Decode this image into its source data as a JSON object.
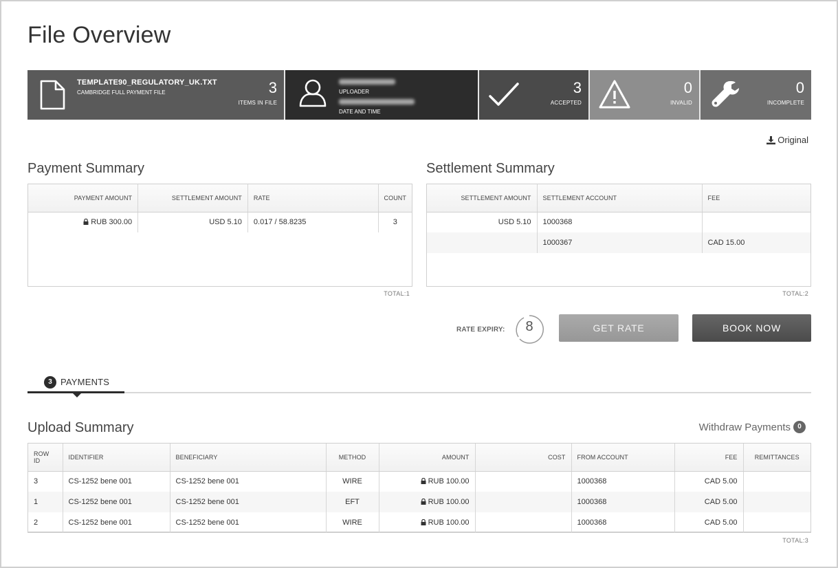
{
  "page": {
    "title": "File Overview"
  },
  "stats": {
    "file": {
      "name": "TEMPLATE90_REGULATORY_UK.TXT",
      "subtitle": "CAMBRIDGE FULL PAYMENT FILE",
      "count": "3",
      "count_label": "ITEMS IN FILE",
      "icon": "file-icon"
    },
    "uploader": {
      "label": "UPLOADER",
      "datetime_label": "DATE AND TIME",
      "icon": "user-icon"
    },
    "accepted": {
      "value": "3",
      "label": "ACCEPTED",
      "icon": "checkmark-icon"
    },
    "invalid": {
      "value": "0",
      "label": "INVALID",
      "icon": "warning-icon"
    },
    "incomplete": {
      "value": "0",
      "label": "INCOMPLETE",
      "icon": "wrench-icon"
    }
  },
  "original_link": {
    "label": "Original",
    "icon": "download-icon"
  },
  "payment_summary": {
    "title": "Payment Summary",
    "columns": [
      "PAYMENT AMOUNT",
      "SETTLEMENT AMOUNT",
      "RATE",
      "COUNT"
    ],
    "rows": [
      {
        "payment_amount": "RUB 300.00",
        "locked": true,
        "settlement_amount": "USD 5.10",
        "rate": "0.017 / 58.8235",
        "count": "3"
      }
    ],
    "total": "TOTAL:1"
  },
  "settlement_summary": {
    "title": "Settlement Summary",
    "columns": [
      "SETTLEMENT AMOUNT",
      "SETTLEMENT ACCOUNT",
      "FEE"
    ],
    "rows": [
      {
        "settlement_amount": "USD 5.10",
        "settlement_account": "1000368",
        "fee": ""
      },
      {
        "settlement_amount": "",
        "settlement_account": "1000367",
        "fee": "CAD 15.00"
      }
    ],
    "total": "TOTAL:2"
  },
  "rate": {
    "expiry_label": "RATE EXPIRY:",
    "expiry_seconds": "8",
    "get_rate_label": "GET RATE",
    "book_now_label": "BOOK NOW"
  },
  "tabs": [
    {
      "label": "PAYMENTS",
      "count": "3",
      "active": true
    }
  ],
  "upload_summary": {
    "title": "Upload Summary",
    "withdraw_label": "Withdraw Payments",
    "withdraw_count": "0",
    "columns": [
      "ROW ID",
      "IDENTIFIER",
      "BENEFICIARY",
      "METHOD",
      "AMOUNT",
      "COST",
      "FROM ACCOUNT",
      "FEE",
      "REMITTANCES"
    ],
    "rows": [
      {
        "row_id": "3",
        "identifier": "CS-1252 bene 001",
        "beneficiary": "CS-1252 bene 001",
        "method": "WIRE",
        "amount": "RUB 100.00",
        "locked": true,
        "cost": "",
        "from_account": "1000368",
        "fee": "CAD 5.00",
        "remittances": ""
      },
      {
        "row_id": "1",
        "identifier": "CS-1252 bene 001",
        "beneficiary": "CS-1252 bene 001",
        "method": "EFT",
        "amount": "RUB 100.00",
        "locked": true,
        "cost": "",
        "from_account": "1000368",
        "fee": "CAD 5.00",
        "remittances": ""
      },
      {
        "row_id": "2",
        "identifier": "CS-1252 bene 001",
        "beneficiary": "CS-1252 bene 001",
        "method": "WIRE",
        "amount": "RUB 100.00",
        "locked": true,
        "cost": "",
        "from_account": "1000368",
        "fee": "CAD 5.00",
        "remittances": ""
      }
    ],
    "total": "TOTAL:3"
  }
}
